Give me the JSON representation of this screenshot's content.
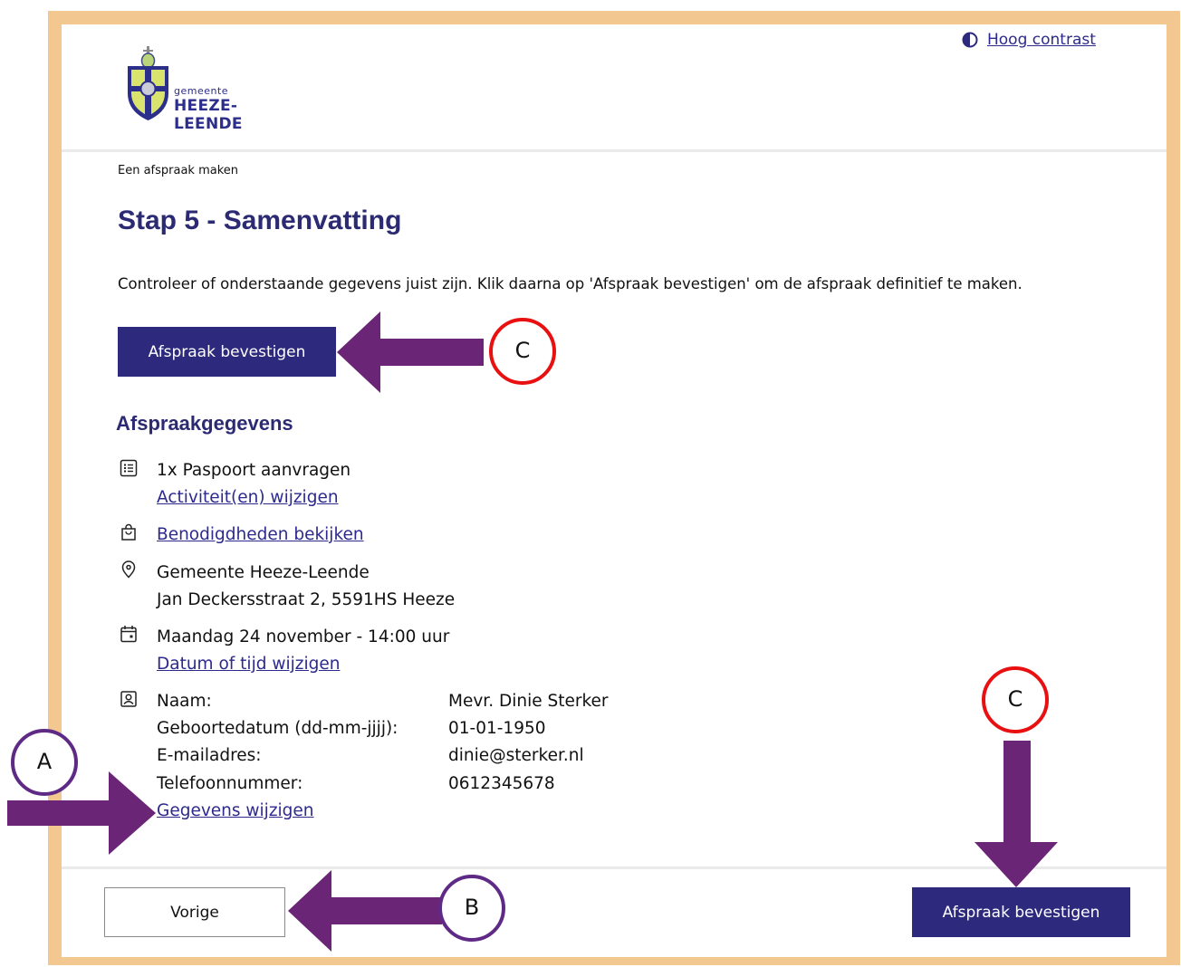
{
  "header": {
    "logo_subtitle": "gemeente",
    "logo_title": "HEEZE-LEENDE",
    "contrast_label": "Hoog contrast"
  },
  "breadcrumb": "Een afspraak maken",
  "page_title": "Stap 5 - Samenvatting",
  "intro": "Controleer of onderstaande gegevens juist zijn. Klik daarna op 'Afspraak bevestigen' om de afspraak definitief te maken.",
  "confirm_label": "Afspraak bevestigen",
  "section_title": "Afspraakgegevens",
  "activity": {
    "text": "1x Paspoort aanvragen",
    "change_link": "Activiteit(en) wijzigen"
  },
  "requirements_link": "Benodigdheden bekijken",
  "location": {
    "name": "Gemeente Heeze-Leende",
    "address": "Jan Deckersstraat 2, 5591HS Heeze"
  },
  "datetime": {
    "text": "Maandag 24 november - 14:00 uur",
    "change_link": "Datum of tijd wijzigen"
  },
  "personal": {
    "fields": [
      {
        "label": "Naam:",
        "value": "Mevr. Dinie Sterker"
      },
      {
        "label": "Geboortedatum (dd-mm-jjjj):",
        "value": "01-01-1950"
      },
      {
        "label": "E-mailadres:",
        "value": "dinie@sterker.nl"
      },
      {
        "label": "Telefoonnummer:",
        "value": "0612345678"
      }
    ],
    "change_link": "Gegevens wijzigen"
  },
  "footer": {
    "previous_label": "Vorige",
    "confirm_label": "Afspraak bevestigen"
  },
  "callouts": {
    "a": "A",
    "b": "B",
    "c": "C"
  },
  "colors": {
    "primary": "#2d2a7e",
    "heading": "#2b2a72",
    "link": "#2d2a8e",
    "frame": "#f3c790",
    "arrow": "#6b2577",
    "circle_red": "#e81010",
    "circle_purple": "#5f2a86"
  }
}
